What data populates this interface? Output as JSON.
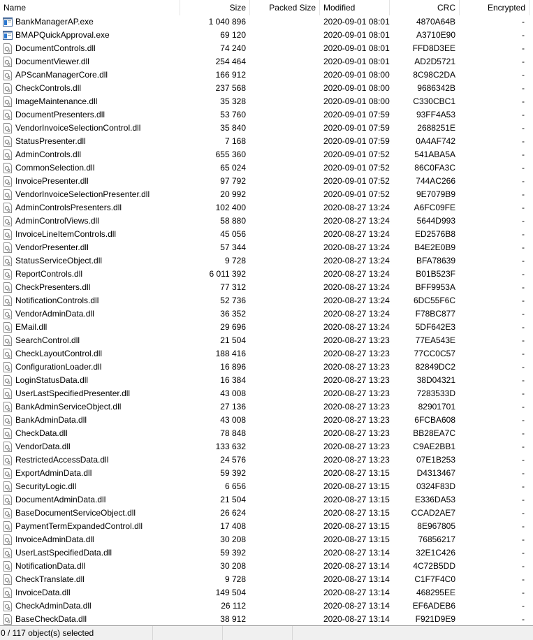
{
  "columns": {
    "name": "Name",
    "size": "Size",
    "packed": "Packed Size",
    "modified": "Modified",
    "crc": "CRC",
    "encrypted": "Encrypted"
  },
  "files": [
    {
      "name": "BankManagerAP.exe",
      "size": "1 040 896",
      "packed": "",
      "modified": "2020-09-01 08:01",
      "crc": "4870A64B",
      "encrypted": "-",
      "icon": "exe-icon"
    },
    {
      "name": "BMAPQuickApproval.exe",
      "size": "69 120",
      "packed": "",
      "modified": "2020-09-01 08:01",
      "crc": "A3710E90",
      "encrypted": "-",
      "icon": "exe-icon"
    },
    {
      "name": "DocumentControls.dll",
      "size": "74 240",
      "packed": "",
      "modified": "2020-09-01 08:01",
      "crc": "FFD8D3EE",
      "encrypted": "-",
      "icon": "dll-icon"
    },
    {
      "name": "DocumentViewer.dll",
      "size": "254 464",
      "packed": "",
      "modified": "2020-09-01 08:01",
      "crc": "AD2D5721",
      "encrypted": "-",
      "icon": "dll-icon"
    },
    {
      "name": "APScanManagerCore.dll",
      "size": "166 912",
      "packed": "",
      "modified": "2020-09-01 08:00",
      "crc": "8C98C2DA",
      "encrypted": "-",
      "icon": "dll-icon"
    },
    {
      "name": "CheckControls.dll",
      "size": "237 568",
      "packed": "",
      "modified": "2020-09-01 08:00",
      "crc": "9686342B",
      "encrypted": "-",
      "icon": "dll-icon"
    },
    {
      "name": "ImageMaintenance.dll",
      "size": "35 328",
      "packed": "",
      "modified": "2020-09-01 08:00",
      "crc": "C330CBC1",
      "encrypted": "-",
      "icon": "dll-icon"
    },
    {
      "name": "DocumentPresenters.dll",
      "size": "53 760",
      "packed": "",
      "modified": "2020-09-01 07:59",
      "crc": "93FF4A53",
      "encrypted": "-",
      "icon": "dll-icon"
    },
    {
      "name": "VendorInvoiceSelectionControl.dll",
      "size": "35 840",
      "packed": "",
      "modified": "2020-09-01 07:59",
      "crc": "2688251E",
      "encrypted": "-",
      "icon": "dll-icon"
    },
    {
      "name": "StatusPresenter.dll",
      "size": "7 168",
      "packed": "",
      "modified": "2020-09-01 07:59",
      "crc": "0A4AF742",
      "encrypted": "-",
      "icon": "dll-icon"
    },
    {
      "name": "AdminControls.dll",
      "size": "655 360",
      "packed": "",
      "modified": "2020-09-01 07:52",
      "crc": "541ABA5A",
      "encrypted": "-",
      "icon": "dll-icon"
    },
    {
      "name": "CommonSelection.dll",
      "size": "65 024",
      "packed": "",
      "modified": "2020-09-01 07:52",
      "crc": "86C0FA3C",
      "encrypted": "-",
      "icon": "dll-icon"
    },
    {
      "name": "InvoicePresenter.dll",
      "size": "97 792",
      "packed": "",
      "modified": "2020-09-01 07:52",
      "crc": "744AC266",
      "encrypted": "-",
      "icon": "dll-icon"
    },
    {
      "name": "VendorInvoiceSelectionPresenter.dll",
      "size": "20 992",
      "packed": "",
      "modified": "2020-09-01 07:52",
      "crc": "9E7079B9",
      "encrypted": "-",
      "icon": "dll-icon"
    },
    {
      "name": "AdminControlsPresenters.dll",
      "size": "102 400",
      "packed": "",
      "modified": "2020-08-27 13:24",
      "crc": "A6FC09FE",
      "encrypted": "-",
      "icon": "dll-icon"
    },
    {
      "name": "AdminControlViews.dll",
      "size": "58 880",
      "packed": "",
      "modified": "2020-08-27 13:24",
      "crc": "5644D993",
      "encrypted": "-",
      "icon": "dll-icon"
    },
    {
      "name": "InvoiceLineItemControls.dll",
      "size": "45 056",
      "packed": "",
      "modified": "2020-08-27 13:24",
      "crc": "ED2576B8",
      "encrypted": "-",
      "icon": "dll-icon"
    },
    {
      "name": "VendorPresenter.dll",
      "size": "57 344",
      "packed": "",
      "modified": "2020-08-27 13:24",
      "crc": "B4E2E0B9",
      "encrypted": "-",
      "icon": "dll-icon"
    },
    {
      "name": "StatusServiceObject.dll",
      "size": "9 728",
      "packed": "",
      "modified": "2020-08-27 13:24",
      "crc": "BFA78639",
      "encrypted": "-",
      "icon": "dll-icon"
    },
    {
      "name": "ReportControls.dll",
      "size": "6 011 392",
      "packed": "",
      "modified": "2020-08-27 13:24",
      "crc": "B01B523F",
      "encrypted": "-",
      "icon": "dll-icon"
    },
    {
      "name": "CheckPresenters.dll",
      "size": "77 312",
      "packed": "",
      "modified": "2020-08-27 13:24",
      "crc": "BFF9953A",
      "encrypted": "-",
      "icon": "dll-icon"
    },
    {
      "name": "NotificationControls.dll",
      "size": "52 736",
      "packed": "",
      "modified": "2020-08-27 13:24",
      "crc": "6DC55F6C",
      "encrypted": "-",
      "icon": "dll-icon"
    },
    {
      "name": "VendorAdminData.dll",
      "size": "36 352",
      "packed": "",
      "modified": "2020-08-27 13:24",
      "crc": "F78BC877",
      "encrypted": "-",
      "icon": "dll-icon"
    },
    {
      "name": "EMail.dll",
      "size": "29 696",
      "packed": "",
      "modified": "2020-08-27 13:24",
      "crc": "5DF642E3",
      "encrypted": "-",
      "icon": "dll-icon"
    },
    {
      "name": "SearchControl.dll",
      "size": "21 504",
      "packed": "",
      "modified": "2020-08-27 13:23",
      "crc": "77EA543E",
      "encrypted": "-",
      "icon": "dll-icon"
    },
    {
      "name": "CheckLayoutControl.dll",
      "size": "188 416",
      "packed": "",
      "modified": "2020-08-27 13:23",
      "crc": "77CC0C57",
      "encrypted": "-",
      "icon": "dll-icon"
    },
    {
      "name": "ConfigurationLoader.dll",
      "size": "16 896",
      "packed": "",
      "modified": "2020-08-27 13:23",
      "crc": "82849DC2",
      "encrypted": "-",
      "icon": "dll-icon"
    },
    {
      "name": "LoginStatusData.dll",
      "size": "16 384",
      "packed": "",
      "modified": "2020-08-27 13:23",
      "crc": "38D04321",
      "encrypted": "-",
      "icon": "dll-icon"
    },
    {
      "name": "UserLastSpecifiedPresenter.dll",
      "size": "43 008",
      "packed": "",
      "modified": "2020-08-27 13:23",
      "crc": "7283533D",
      "encrypted": "-",
      "icon": "dll-icon"
    },
    {
      "name": "BankAdminServiceObject.dll",
      "size": "27 136",
      "packed": "",
      "modified": "2020-08-27 13:23",
      "crc": "82901701",
      "encrypted": "-",
      "icon": "dll-icon"
    },
    {
      "name": "BankAdminData.dll",
      "size": "43 008",
      "packed": "",
      "modified": "2020-08-27 13:23",
      "crc": "6FCBA608",
      "encrypted": "-",
      "icon": "dll-icon"
    },
    {
      "name": "CheckData.dll",
      "size": "78 848",
      "packed": "",
      "modified": "2020-08-27 13:23",
      "crc": "BB28EA7C",
      "encrypted": "-",
      "icon": "dll-icon"
    },
    {
      "name": "VendorData.dll",
      "size": "133 632",
      "packed": "",
      "modified": "2020-08-27 13:23",
      "crc": "C9AE2BB1",
      "encrypted": "-",
      "icon": "dll-icon"
    },
    {
      "name": "RestrictedAccessData.dll",
      "size": "24 576",
      "packed": "",
      "modified": "2020-08-27 13:23",
      "crc": "07E1B253",
      "encrypted": "-",
      "icon": "dll-icon"
    },
    {
      "name": "ExportAdminData.dll",
      "size": "59 392",
      "packed": "",
      "modified": "2020-08-27 13:15",
      "crc": "D4313467",
      "encrypted": "-",
      "icon": "dll-icon"
    },
    {
      "name": "SecurityLogic.dll",
      "size": "6 656",
      "packed": "",
      "modified": "2020-08-27 13:15",
      "crc": "0324F83D",
      "encrypted": "-",
      "icon": "dll-icon"
    },
    {
      "name": "DocumentAdminData.dll",
      "size": "21 504",
      "packed": "",
      "modified": "2020-08-27 13:15",
      "crc": "E336DA53",
      "encrypted": "-",
      "icon": "dll-icon"
    },
    {
      "name": "BaseDocumentServiceObject.dll",
      "size": "26 624",
      "packed": "",
      "modified": "2020-08-27 13:15",
      "crc": "CCAD2AE7",
      "encrypted": "-",
      "icon": "dll-icon"
    },
    {
      "name": "PaymentTermExpandedControl.dll",
      "size": "17 408",
      "packed": "",
      "modified": "2020-08-27 13:15",
      "crc": "8E967805",
      "encrypted": "-",
      "icon": "dll-icon"
    },
    {
      "name": "InvoiceAdminData.dll",
      "size": "30 208",
      "packed": "",
      "modified": "2020-08-27 13:15",
      "crc": "76856217",
      "encrypted": "-",
      "icon": "dll-icon"
    },
    {
      "name": "UserLastSpecifiedData.dll",
      "size": "59 392",
      "packed": "",
      "modified": "2020-08-27 13:14",
      "crc": "32E1C426",
      "encrypted": "-",
      "icon": "dll-icon"
    },
    {
      "name": "NotificationData.dll",
      "size": "30 208",
      "packed": "",
      "modified": "2020-08-27 13:14",
      "crc": "4C72B5DD",
      "encrypted": "-",
      "icon": "dll-icon"
    },
    {
      "name": "CheckTranslate.dll",
      "size": "9 728",
      "packed": "",
      "modified": "2020-08-27 13:14",
      "crc": "C1F7F4C0",
      "encrypted": "-",
      "icon": "dll-icon"
    },
    {
      "name": "InvoiceData.dll",
      "size": "149 504",
      "packed": "",
      "modified": "2020-08-27 13:14",
      "crc": "468295EE",
      "encrypted": "-",
      "icon": "dll-icon"
    },
    {
      "name": "CheckAdminData.dll",
      "size": "26 112",
      "packed": "",
      "modified": "2020-08-27 13:14",
      "crc": "EF6ADEB6",
      "encrypted": "-",
      "icon": "dll-icon"
    },
    {
      "name": "BaseCheckData.dll",
      "size": "38 912",
      "packed": "",
      "modified": "2020-08-27 13:14",
      "crc": "F921D9E9",
      "encrypted": "-",
      "icon": "dll-icon"
    }
  ],
  "status": {
    "selection": "0 / 117 object(s) selected",
    "panel2": "",
    "panel3": "",
    "panel4": ""
  }
}
